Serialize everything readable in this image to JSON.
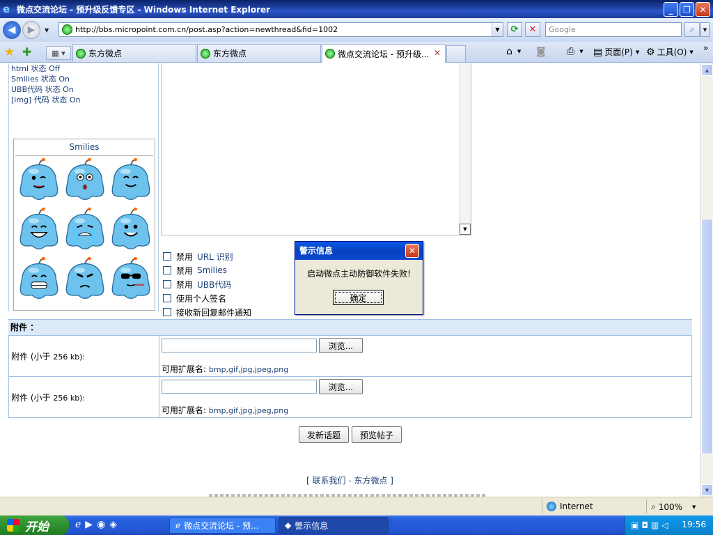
{
  "window": {
    "title": "微点交流论坛 - 预升级反馈专区 - Windows Internet Explorer"
  },
  "address": {
    "url": "http://bbs.micropoint.com.cn/post.asp?action=newthread&fid=1002",
    "search_placeholder": "Google"
  },
  "tabs": [
    {
      "label": "东方微点"
    },
    {
      "label": "东方微点"
    },
    {
      "label": "微点交流论坛 - 预升级..."
    }
  ],
  "commands": {
    "page": "页面(P)",
    "tools": "工具(O)"
  },
  "forum": {
    "status_lines": [
      {
        "name": "html 状态",
        "value": "Off"
      },
      {
        "name": "Smilies 状态",
        "value": "On"
      },
      {
        "name": "UBB代码 状态",
        "value": "On"
      },
      {
        "name": "[img] 代码 状态",
        "value": "On"
      }
    ],
    "smilies_title": "Smilies",
    "options": [
      {
        "label": "禁用",
        "latin": "URL 识别"
      },
      {
        "label": "禁用",
        "latin": "Smilies"
      },
      {
        "label": "禁用",
        "latin": "UBB代码"
      },
      {
        "label": "使用个人签名",
        "latin": ""
      },
      {
        "label": "接收新回复邮件通知",
        "latin": ""
      }
    ],
    "attach_header": "附件 ：",
    "attachments": [
      {
        "label": "附件 (小于",
        "size": "256 kb):",
        "browse": "浏览...",
        "ext_label": "可用扩展名:",
        "ext": "bmp,gif,jpg,jpeg,png"
      },
      {
        "label": "附件 (小于",
        "size": "256 kb):",
        "browse": "浏览...",
        "ext_label": "可用扩展名:",
        "ext": "bmp,gif,jpg,jpeg,png"
      }
    ],
    "submit_label": "发新话题",
    "preview_label": "预览帖子",
    "footer": "[ 联系我们  - 东方微点  ]"
  },
  "statusbar": {
    "zone": "Internet",
    "zoom": "100%"
  },
  "taskbar": {
    "start": "开始",
    "tasks": [
      {
        "label": "微点交流论坛 - 预..."
      },
      {
        "label": "警示信息"
      }
    ],
    "clock": "19:56"
  },
  "dialog": {
    "title": "警示信息",
    "message": "启动微点主动防御软件失败!",
    "ok": "确定"
  },
  "colors": {
    "link_text": "#1a3f78",
    "attach_header_bg": "#dbe9f9",
    "titlebar": "#0a246a"
  }
}
